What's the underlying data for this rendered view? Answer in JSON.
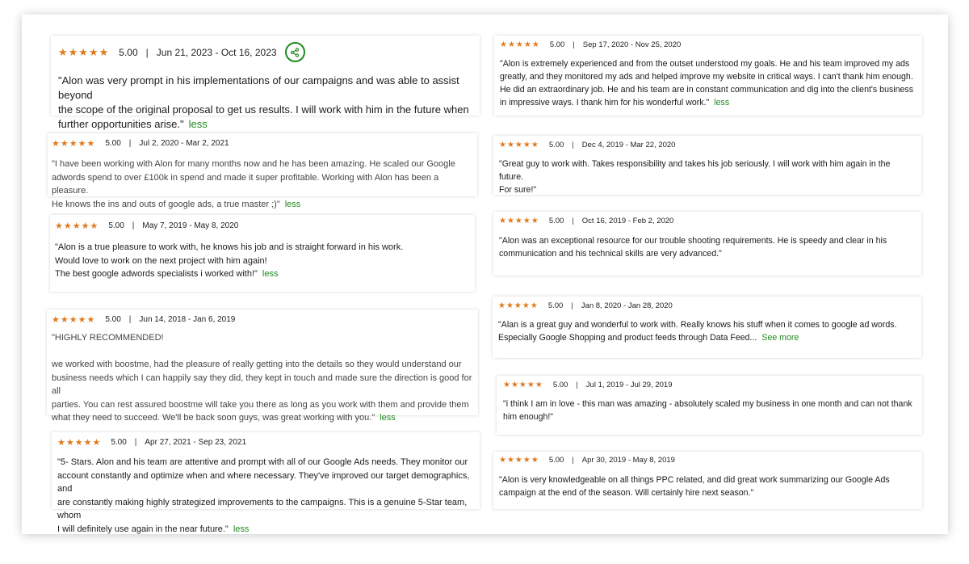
{
  "less_label": "less",
  "see_more_label": "See more",
  "separator": "|",
  "stars": "★★★★★",
  "reviews": [
    {
      "score": "5.00",
      "dates": "Jun 21, 2023 - Oct 16, 2023",
      "lines": [
        "\"Alon was very prompt in his implementations of our campaigns and was able to assist beyond",
        "the scope of the original proposal to get us results. I will work with him in the future when",
        "further opportunities arise.\""
      ],
      "toggle": "less"
    },
    {
      "score": "5.00",
      "dates": "Jul 2, 2020 - Mar 2, 2021",
      "lines": [
        "\"I have been working with Alon for many months now and he has been amazing. He scaled our Google",
        "adwords spend to over £100k in spend and made it super profitable. Working with Alon has been a pleasure.",
        "He knows the ins and outs of google ads, a true master ;)\""
      ],
      "toggle": "less"
    },
    {
      "score": "5.00",
      "dates": "May 7, 2019 - May 8, 2020",
      "lines": [
        "\"Alon is a true pleasure to work with, he knows his job and is straight forward in his work.",
        "Would love to work on the next project with him again!",
        "The best google adwords specialists i worked with!\""
      ],
      "toggle": "less"
    },
    {
      "score": "5.00",
      "dates": "Jun 14, 2018 - Jan 6, 2019",
      "lines": [
        "\"HIGHLY RECOMMENDED!",
        "",
        "we worked with boostme, had the pleasure of really getting into the details so they would understand our",
        "business needs which I can happily say they did, they kept in touch and made sure the direction is good for all",
        "parties. You can rest assured boostme will take you there as long as you work with them and provide them",
        "what they need to succeed. We'll be back soon guys, was great working with you.\""
      ],
      "toggle": "less"
    },
    {
      "score": "5.00",
      "dates": "Apr 27, 2021 - Sep 23, 2021",
      "lines": [
        "\"5- Stars. Alon and his team are attentive and prompt with all of our Google Ads needs. They monitor our",
        "account constantly and optimize when and where necessary. They've improved our target demographics, and",
        "are constantly making highly strategized improvements to the campaigns. This is a genuine 5-Star team, whom",
        "I will definitely use again in the near future.\""
      ],
      "toggle": "less"
    },
    {
      "score": "5.00",
      "dates": "Sep 17, 2020 - Nov 25, 2020",
      "lines": [
        "\"Alon is extremely experienced and from the outset understood my goals. He and his team improved my ads",
        "greatly, and they monitored my ads and helped improve my website in critical ways. I can't thank him enough.",
        "He did an extraordinary job. He and his team are in constant communication and dig into the client's business",
        "in impressive ways. I thank him for his wonderful work.\""
      ],
      "toggle": "less"
    },
    {
      "score": "5.00",
      "dates": "Dec 4, 2019 - Mar 22, 2020",
      "lines": [
        "\"Great guy to work with. Takes responsibility and takes his job seriously. I will work with him again in the future.",
        "For sure!\""
      ]
    },
    {
      "score": "5.00",
      "dates": "Oct 16, 2019 - Feb 2, 2020",
      "lines": [
        "\"Alon was an exceptional resource for our trouble shooting requirements. He is speedy and clear in his",
        "communication and his technical skills are very advanced.\""
      ]
    },
    {
      "score": "5.00",
      "dates": "Jan 8, 2020 - Jan 28, 2020",
      "lines": [
        "\"Alan is a great guy and wonderful to work with. Really knows his stuff when it comes to google ad words.",
        "Especially Google Shopping and product feeds through Data Feed..."
      ],
      "toggle": "See more"
    },
    {
      "score": "5.00",
      "dates": "Jul 1, 2019 - Jul 29, 2019",
      "lines": [
        "\"i think I am in love - this man was amazing - absolutely scaled my business in one month and can not thank",
        "him enough!\""
      ]
    },
    {
      "score": "5.00",
      "dates": "Apr 30, 2019 - May 8, 2019",
      "lines": [
        "\"Alon is very knowledgeable on all things PPC related, and did great work summarizing our Google Ads",
        "campaign at the end of the season. Will certainly hire next season.\""
      ]
    }
  ]
}
